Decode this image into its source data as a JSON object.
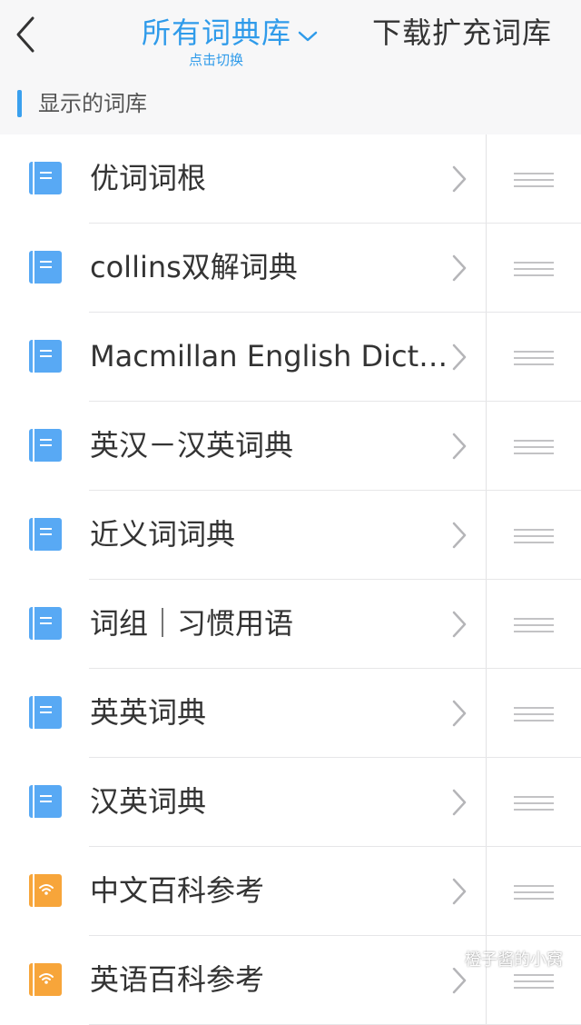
{
  "nav": {
    "title": "所有词典库",
    "subtitle": "点击切换",
    "right_action": "下载扩充词库",
    "accent_color": "#2f9bea"
  },
  "section": {
    "title": "显示的词库"
  },
  "dictionaries": [
    {
      "label": "优词词根",
      "icon": "book-icon",
      "icon_color": "#58a9f4"
    },
    {
      "label": "collins双解词典",
      "icon": "book-icon",
      "icon_color": "#58a9f4"
    },
    {
      "label": "Macmillan English Dicti...",
      "icon": "book-icon",
      "icon_color": "#58a9f4"
    },
    {
      "label": "英汉－汉英词典",
      "icon": "book-icon",
      "icon_color": "#58a9f4"
    },
    {
      "label": "近义词词典",
      "icon": "book-icon",
      "icon_color": "#58a9f4"
    },
    {
      "label": "词组｜习惯用语",
      "icon": "book-icon",
      "icon_color": "#58a9f4"
    },
    {
      "label": "英英词典",
      "icon": "book-icon",
      "icon_color": "#58a9f4"
    },
    {
      "label": "汉英词典",
      "icon": "book-icon",
      "icon_color": "#58a9f4"
    },
    {
      "label": "中文百科参考",
      "icon": "online-book-icon",
      "icon_color": "#f7a53a"
    },
    {
      "label": "英语百科参考",
      "icon": "online-book-icon",
      "icon_color": "#f7a53a"
    }
  ],
  "watermark": {
    "text": "橙子酱的小窝",
    "icon": "wechat-icon"
  }
}
